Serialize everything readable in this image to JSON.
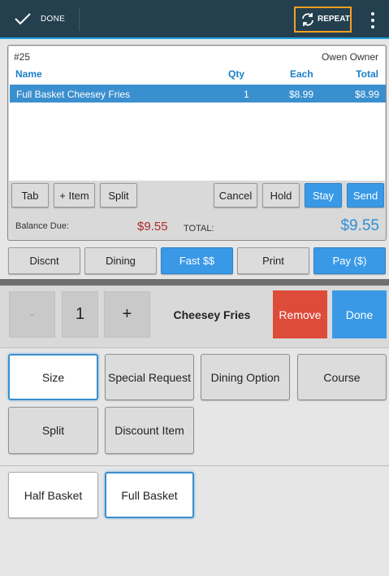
{
  "topbar": {
    "done_label": "DONE",
    "repeat_label": "REPEAT"
  },
  "order": {
    "ticket": "#25",
    "owner": "Owen Owner",
    "columns": {
      "name": "Name",
      "qty": "Qty",
      "each": "Each",
      "total": "Total"
    },
    "items": [
      {
        "name": "Full Basket Cheesey Fries",
        "qty": "1",
        "each": "$8.99",
        "total": "$8.99"
      }
    ],
    "buttons": {
      "tab": "Tab",
      "add_item": "+ Item",
      "split": "Split",
      "cancel": "Cancel",
      "hold": "Hold",
      "stay": "Stay",
      "send": "Send"
    },
    "balance_label": "Balance Due:",
    "balance_value": "$9.55",
    "total_label": "TOTAL:",
    "total_value": "$9.55"
  },
  "actions": {
    "discount": "Discnt",
    "dining": "Dining",
    "fast": "Fast $$",
    "print": "Print",
    "pay": "Pay ($)"
  },
  "editor": {
    "minus": "-",
    "quantity": "1",
    "plus": "+",
    "item_name": "Cheesey Fries",
    "remove": "Remove",
    "done": "Done"
  },
  "modifiers": {
    "size": "Size",
    "special_request": "Special Request",
    "dining_option": "Dining Option",
    "course": "Course",
    "split": "Split",
    "discount_item": "Discount Item"
  },
  "choices": {
    "half_basket": "Half Basket",
    "full_basket": "Full Basket"
  },
  "colors": {
    "topbar": "#243f4e",
    "accent": "#3999e6",
    "remove": "#dd4b39",
    "repeat_highlight": "#f5a023"
  }
}
